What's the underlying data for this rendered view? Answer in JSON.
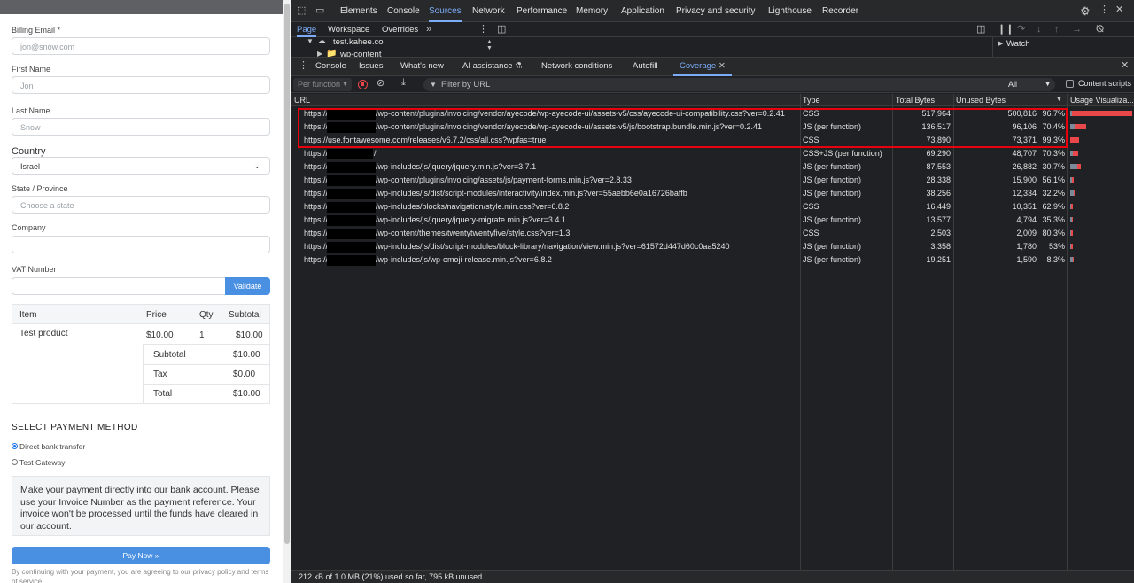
{
  "checkout": {
    "billing_email_label": "Billing Email *",
    "billing_email_placeholder": "jon@snow.com",
    "first_name_label": "First Name",
    "first_name_placeholder": "Jon",
    "last_name_label": "Last Name",
    "last_name_placeholder": "Snow",
    "country_label": "Country",
    "country_value": "Israel",
    "state_label": "State / Province",
    "state_placeholder": "Choose a state",
    "company_label": "Company",
    "vat_label": "VAT Number",
    "validate_label": "Validate",
    "table": {
      "headers": [
        "Item",
        "Price",
        "Qty",
        "Subtotal"
      ],
      "item": {
        "name": "Test product",
        "price": "$10.00",
        "qty": "1",
        "subtotal": "$10.00"
      },
      "summary": [
        {
          "label": "Subtotal",
          "value": "$10.00"
        },
        {
          "label": "Tax",
          "value": "$0.00"
        },
        {
          "label": "Total",
          "value": "$10.00"
        }
      ]
    },
    "payment_title": "SELECT PAYMENT METHOD",
    "methods": [
      {
        "label": "Direct bank transfer",
        "selected": true
      },
      {
        "label": "Test Gateway",
        "selected": false
      }
    ],
    "payment_message": "Make your payment directly into our bank account. Please use your Invoice Number as the payment reference. Your invoice won't be processed until the funds have cleared in our account.",
    "pay_button": "Pay Now »",
    "terms": "By continuing with your payment, you are agreeing to our privacy policy and terms of service."
  },
  "devtools": {
    "tabs": [
      "Elements",
      "Console",
      "Sources",
      "Network",
      "Performance",
      "Memory",
      "Application",
      "Privacy and security",
      "Lighthouse",
      "Recorder"
    ],
    "active_tab": "Sources",
    "sources_tabs": [
      "Page",
      "Workspace",
      "Overrides"
    ],
    "tree": {
      "site": "test.kahee.co",
      "folder": "wp-content"
    },
    "watch_label": "Watch",
    "panel_tabs": [
      "Console",
      "Issues",
      "What's new",
      "AI assistance",
      "Network conditions",
      "Autofill",
      "Coverage"
    ],
    "coverage": {
      "mode": "Per function",
      "filter_placeholder": "Filter by URL",
      "type_filter": "All",
      "content_scripts_label": "Content scripts",
      "columns": [
        "URL",
        "Type",
        "Total Bytes",
        "Unused Bytes",
        "Usage Visualiza..."
      ],
      "rows": [
        {
          "url_prefix": "https://",
          "url_rest": "/wp-content/plugins/invoicing/vendor/ayecode/wp-ayecode-ui/assets-v5/css/ayecode-ui-compatibility.css?ver=0.2.41",
          "redacted": true,
          "type": "CSS",
          "total": "517,964",
          "unused": "500,816",
          "pct": "96.7%",
          "used_fraction": 0.033,
          "size_fraction": 1.0
        },
        {
          "url_prefix": "https://",
          "url_rest": "/wp-content/plugins/invoicing/vendor/ayecode/wp-ayecode-ui/assets-v5/js/bootstrap.bundle.min.js?ver=0.2.41",
          "redacted": true,
          "type": "JS (per function)",
          "total": "136,517",
          "unused": "96,106",
          "pct": "70.4%",
          "used_fraction": 0.296,
          "size_fraction": 0.264
        },
        {
          "url_prefix": "https://use.fontawesome.com/releases/v6.7.2/css/all.css?wpfas=true",
          "url_rest": "",
          "redacted": false,
          "type": "CSS",
          "total": "73,890",
          "unused": "73,371",
          "pct": "99.3%",
          "used_fraction": 0.007,
          "size_fraction": 0.143
        },
        {
          "url_prefix": "https://",
          "url_rest": "/",
          "redacted": true,
          "type": "CSS+JS (per function)",
          "total": "69,290",
          "unused": "48,707",
          "pct": "70.3%",
          "used_fraction": 0.297,
          "size_fraction": 0.134
        },
        {
          "url_prefix": "https://",
          "url_rest": "/wp-includes/js/jquery/jquery.min.js?ver=3.7.1",
          "redacted": true,
          "type": "JS (per function)",
          "total": "87,553",
          "unused": "26,882",
          "pct": "30.7%",
          "used_fraction": 0.693,
          "size_fraction": 0.169
        },
        {
          "url_prefix": "https://",
          "url_rest": "/wp-content/plugins/invoicing/assets/js/payment-forms.min.js?ver=2.8.33",
          "redacted": true,
          "type": "JS (per function)",
          "total": "28,338",
          "unused": "15,900",
          "pct": "56.1%",
          "used_fraction": 0.439,
          "size_fraction": 0.055
        },
        {
          "url_prefix": "https://",
          "url_rest": "/wp-includes/js/dist/script-modules/interactivity/index.min.js?ver=55aebb6e0a16726baffb",
          "redacted": true,
          "type": "JS (per function)",
          "total": "38,256",
          "unused": "12,334",
          "pct": "32.2%",
          "used_fraction": 0.678,
          "size_fraction": 0.074
        },
        {
          "url_prefix": "https://",
          "url_rest": "/wp-includes/blocks/navigation/style.min.css?ver=6.8.2",
          "redacted": true,
          "type": "CSS",
          "total": "16,449",
          "unused": "10,351",
          "pct": "62.9%",
          "used_fraction": 0.371,
          "size_fraction": 0.032
        },
        {
          "url_prefix": "https://",
          "url_rest": "/wp-includes/js/jquery/jquery-migrate.min.js?ver=3.4.1",
          "redacted": true,
          "type": "JS (per function)",
          "total": "13,577",
          "unused": "4,794",
          "pct": "35.3%",
          "used_fraction": 0.647,
          "size_fraction": 0.026
        },
        {
          "url_prefix": "https://",
          "url_rest": "/wp-content/themes/twentytwentyfive/style.css?ver=1.3",
          "redacted": true,
          "type": "CSS",
          "total": "2,503",
          "unused": "2,009",
          "pct": "80.3%",
          "used_fraction": 0.197,
          "size_fraction": 0.005
        },
        {
          "url_prefix": "https://",
          "url_rest": "/wp-includes/js/dist/script-modules/block-library/navigation/view.min.js?ver=61572d447d60c0aa5240",
          "redacted": true,
          "type": "JS (per function)",
          "total": "3,358",
          "unused": "1,780",
          "pct": "53%",
          "used_fraction": 0.47,
          "size_fraction": 0.006
        },
        {
          "url_prefix": "https://",
          "url_rest": "/wp-includes/js/wp-emoji-release.min.js?ver=6.8.2",
          "redacted": true,
          "type": "JS (per function)",
          "total": "19,251",
          "unused": "1,590",
          "pct": "8.3%",
          "used_fraction": 0.917,
          "size_fraction": 0.037
        }
      ],
      "status": "212 kB of 1.0 MB (21%) used so far, 795 kB unused."
    }
  }
}
